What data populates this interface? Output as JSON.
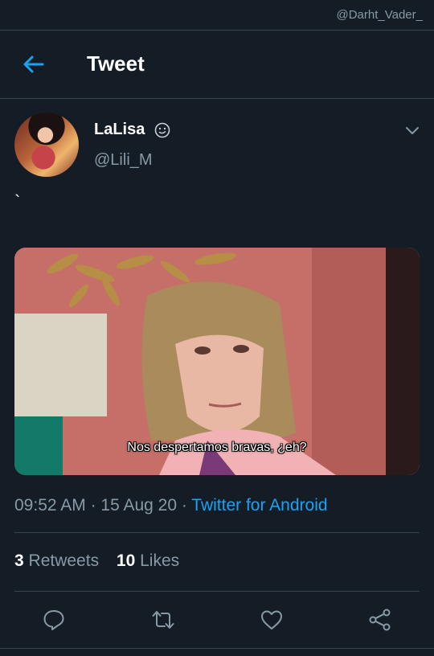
{
  "watermark": "@Darht_Vader_",
  "header": {
    "title": "Tweet",
    "back_icon": "arrow-left-icon"
  },
  "tweet": {
    "display_name": "LaLisa",
    "name_emoji": "smirk-emoji",
    "handle": "@Lili_M",
    "text": "`",
    "media": {
      "subtitle": "Nos despertamos bravas, ¿eh?"
    },
    "time": "09:52 AM",
    "date": "15 Aug 20",
    "source": "Twitter for Android",
    "retweets_count": "3",
    "retweets_label": "Retweets",
    "likes_count": "10",
    "likes_label": "Likes"
  },
  "actions": [
    "reply-icon",
    "retweet-icon",
    "like-icon",
    "share-icon"
  ],
  "colors": {
    "background": "#141d26",
    "accent": "#1da1f2",
    "muted": "#8899a6",
    "divider": "#38444d"
  }
}
